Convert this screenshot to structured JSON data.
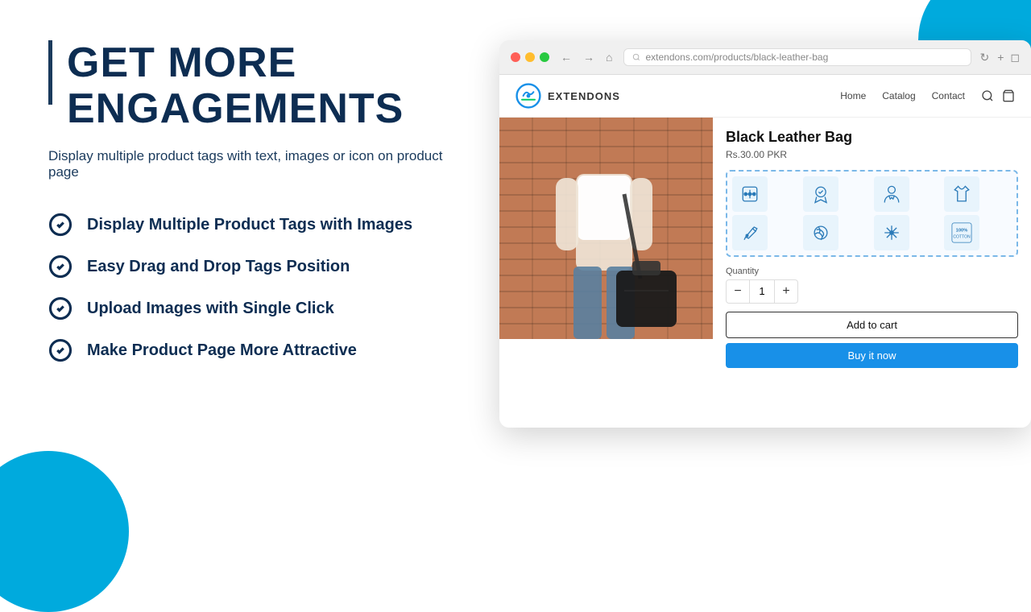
{
  "heading": "GET MORE ENGAGEMENTS",
  "subheading": "Display multiple product tags with text, images or icon on product page",
  "features": [
    {
      "label": "Display Multiple Product Tags with Images"
    },
    {
      "label": "Easy Drag and Drop Tags Position"
    },
    {
      "label": "Upload Images with Single Click"
    },
    {
      "label": "Make Product Page More Attractive"
    }
  ],
  "browser": {
    "address": "extendons.com/products/black-leather-bag"
  },
  "store": {
    "logo_text": "EXTENDONS",
    "nav_links": [
      "Home",
      "Catalog",
      "Contact"
    ],
    "product": {
      "title": "Black Leather Bag",
      "price": "Rs.30.00 PKR",
      "quantity_label": "Quantity",
      "quantity_value": "1",
      "add_to_cart": "Add to cart",
      "buy_now": "Buy it now"
    }
  }
}
